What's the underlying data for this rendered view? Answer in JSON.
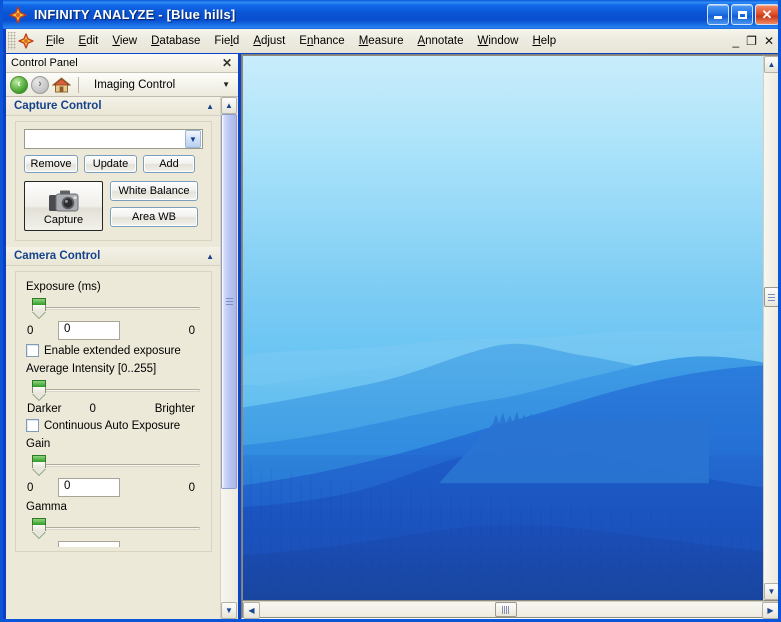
{
  "window": {
    "title": "INFINITY ANALYZE - [Blue hills]",
    "app_icon": "star-burst-icon",
    "buttons": {
      "minimize": "_",
      "maximize": "□",
      "close": "✕"
    },
    "titlebar_color": "#0a54d4",
    "accent_color": "#15428b"
  },
  "menubar": {
    "items": [
      {
        "label": "File",
        "accel": "F"
      },
      {
        "label": "Edit",
        "accel": "E"
      },
      {
        "label": "View",
        "accel": "V"
      },
      {
        "label": "Database",
        "accel": "D"
      },
      {
        "label": "Field",
        "accel": "l"
      },
      {
        "label": "Adjust",
        "accel": "A"
      },
      {
        "label": "Enhance",
        "accel": "n"
      },
      {
        "label": "Measure",
        "accel": "M"
      },
      {
        "label": "Annotate",
        "accel": "A"
      },
      {
        "label": "Window",
        "accel": "W"
      },
      {
        "label": "Help",
        "accel": "H"
      }
    ],
    "mdi_buttons": {
      "minimize": "_",
      "restore": "❐",
      "close": "✕"
    }
  },
  "control_panel": {
    "caption": "Control Panel",
    "close_label": "✕",
    "nav": {
      "back": "back-arrow",
      "forward": "forward-arrow",
      "home": "home-icon"
    },
    "selector": {
      "value": "Imaging Control",
      "caret": "▼"
    },
    "capture_control": {
      "title": "Capture Control",
      "collapse_glyph": "▲",
      "preset_combo": {
        "value": "",
        "caret": "▼"
      },
      "remove_label": "Remove",
      "update_label": "Update",
      "add_label": "Add",
      "capture_label": "Capture",
      "white_balance_label": "White Balance",
      "area_wb_label": "Area WB"
    },
    "camera_control": {
      "title": "Camera Control",
      "collapse_glyph": "▲",
      "exposure": {
        "label": "Exposure (ms)",
        "min": "0",
        "max": "0",
        "value": "0"
      },
      "extended_exposure": {
        "label": "Enable extended exposure",
        "checked": false
      },
      "average_intensity": {
        "label": "Average Intensity [0..255]",
        "min_label": "Darker",
        "mid": "0",
        "max_label": "Brighter"
      },
      "continuous_auto_exposure": {
        "label": "Continuous Auto Exposure",
        "checked": false
      },
      "gain": {
        "label": "Gain",
        "min": "0",
        "max": "0",
        "value": "0"
      },
      "gamma": {
        "label": "Gamma"
      }
    },
    "scrollbar": {
      "up_glyph": "▲",
      "down_glyph": "▼"
    }
  },
  "image_window": {
    "document_title": "Blue hills",
    "vscroll": {
      "up_glyph": "▲",
      "down_glyph": "▼"
    },
    "hscroll": {
      "left_glyph": "◀",
      "right_glyph": "▶"
    }
  }
}
